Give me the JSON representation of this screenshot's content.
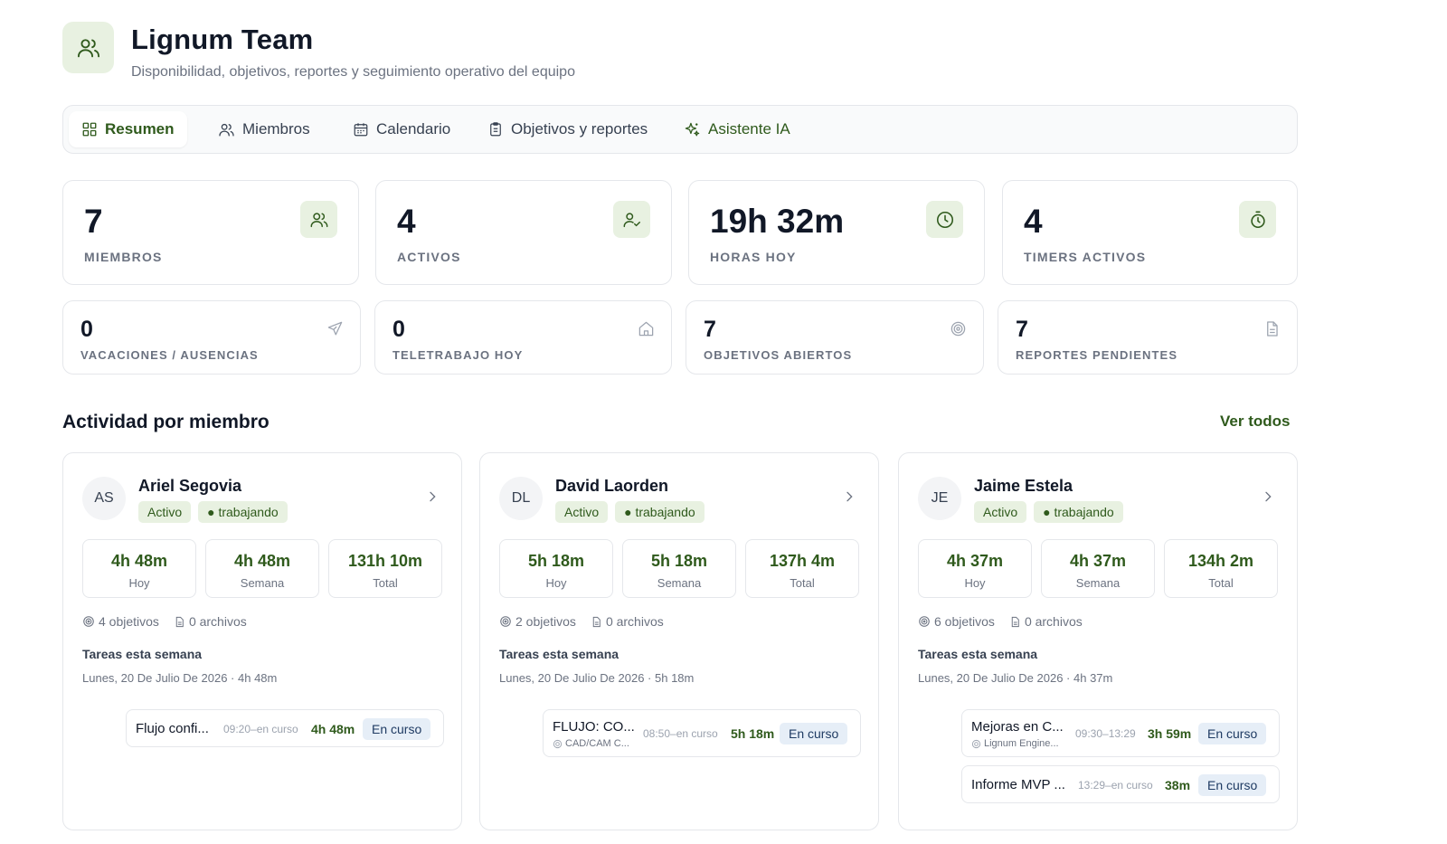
{
  "header": {
    "title": "Lignum Team",
    "subtitle": "Disponibilidad, objetivos, reportes y seguimiento operativo del equipo"
  },
  "tabs": [
    {
      "label": "Resumen",
      "icon": "grid-icon",
      "active": true
    },
    {
      "label": "Miembros",
      "icon": "users-icon"
    },
    {
      "label": "Calendario",
      "icon": "calendar-icon"
    },
    {
      "label": "Objetivos y reportes",
      "icon": "clipboard-icon"
    },
    {
      "label": "Asistente IA",
      "icon": "sparkles-icon"
    }
  ],
  "stats_primary": [
    {
      "value": "7",
      "label": "MIEMBROS",
      "icon": "users-icon"
    },
    {
      "value": "4",
      "label": "ACTIVOS",
      "icon": "user-check-icon"
    },
    {
      "value": "19h 32m",
      "label": "HORAS HOY",
      "icon": "clock-icon"
    },
    {
      "value": "4",
      "label": "TIMERS ACTIVOS",
      "icon": "timer-icon"
    }
  ],
  "stats_secondary": [
    {
      "value": "0",
      "label": "VACACIONES / AUSENCIAS",
      "icon": "plane-icon"
    },
    {
      "value": "0",
      "label": "TELETRABAJO HOY",
      "icon": "home-icon"
    },
    {
      "value": "7",
      "label": "OBJETIVOS ABIERTOS",
      "icon": "target-icon"
    },
    {
      "value": "7",
      "label": "REPORTES PENDIENTES",
      "icon": "file-icon"
    }
  ],
  "activity": {
    "title": "Actividad por miembro",
    "see_all": "Ver todos",
    "members": [
      {
        "initials": "AS",
        "name": "Ariel Segovia",
        "badges": [
          "Activo",
          "● trabajando"
        ],
        "metrics": [
          {
            "value": "4h 48m",
            "label": "Hoy"
          },
          {
            "value": "4h 48m",
            "label": "Semana"
          },
          {
            "value": "131h 10m",
            "label": "Total"
          }
        ],
        "objectives": "4 objetivos",
        "files": "0 archivos",
        "tasks_title": "Tareas esta semana",
        "tasks_date": "Lunes, 20 De Julio De 2026 · 4h 48m",
        "tasks": [
          {
            "name": "Flujo confi...",
            "sub": "",
            "time": "09:20–en curso",
            "duration": "4h 48m",
            "status": "En curso"
          }
        ]
      },
      {
        "initials": "DL",
        "name": "David Laorden",
        "badges": [
          "Activo",
          "● trabajando"
        ],
        "metrics": [
          {
            "value": "5h 18m",
            "label": "Hoy"
          },
          {
            "value": "5h 18m",
            "label": "Semana"
          },
          {
            "value": "137h 4m",
            "label": "Total"
          }
        ],
        "objectives": "2 objetivos",
        "files": "0 archivos",
        "tasks_title": "Tareas esta semana",
        "tasks_date": "Lunes, 20 De Julio De 2026 · 5h 18m",
        "tasks": [
          {
            "name": "FLUJO: CO...",
            "sub": "CAD/CAM C...",
            "time": "08:50–en curso",
            "duration": "5h 18m",
            "status": "En curso"
          }
        ]
      },
      {
        "initials": "JE",
        "name": "Jaime Estela",
        "badges": [
          "Activo",
          "● trabajando"
        ],
        "metrics": [
          {
            "value": "4h 37m",
            "label": "Hoy"
          },
          {
            "value": "4h 37m",
            "label": "Semana"
          },
          {
            "value": "134h 2m",
            "label": "Total"
          }
        ],
        "objectives": "6 objetivos",
        "files": "0 archivos",
        "tasks_title": "Tareas esta semana",
        "tasks_date": "Lunes, 20 De Julio De 2026 · 4h 37m",
        "tasks": [
          {
            "name": "Mejoras en C...",
            "sub": "Lignum Engine...",
            "time": "09:30–13:29",
            "duration": "3h 59m",
            "status": "En curso"
          },
          {
            "name": "Informe MVP ...",
            "sub": "",
            "time": "13:29–en curso",
            "duration": "38m",
            "status": "En curso"
          }
        ]
      }
    ]
  },
  "colors": {
    "accent": "#2f5a1c",
    "accent_bg": "#e8f1e1",
    "status_bg": "#e6eef7"
  }
}
